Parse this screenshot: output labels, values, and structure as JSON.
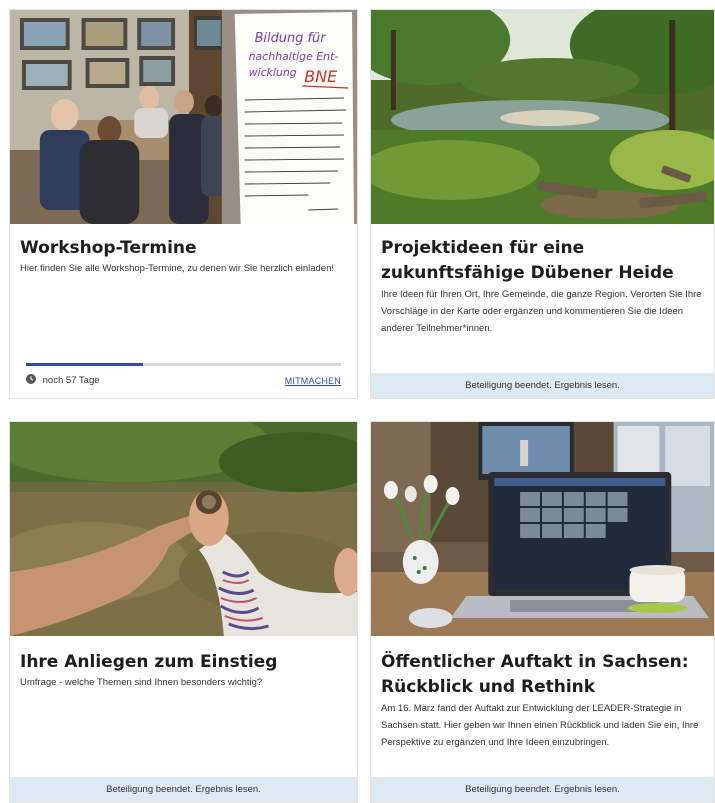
{
  "cards": [
    {
      "title": "Workshop-Termine",
      "description": "Hier finden Sie alle Workshop-Termine, zu denen wir Sie herzlich einladen!",
      "progress": 0.37,
      "days_left": "noch 57 Tage",
      "action_label": "MITMACHEN",
      "image": "workshop-group-flipchart-photo",
      "flipchart_text": "Bildung für nachhaltige Entwicklung BNE"
    },
    {
      "title": "Projektideen für eine zukunftsfähige Dübener Heide",
      "description": "Ihre Ideen für Ihren Ort, Ihre Gemeinde, die ganze Region. Verorten Sie Ihre Vorschläge in der Karte oder ergänzen und kommentieren Sie die Ideen anderer Teilnehmer*innen.",
      "status": "Beteiligung beendet. Ergebnis lesen.",
      "image": "heath-lake-with-benches-photo"
    },
    {
      "title": "Ihre Anliegen zum Einstieg",
      "description": "Umfrage - welche Themen sind Ihnen besonders wichtig?",
      "status": "Beteiligung beendet. Ergebnis lesen.",
      "image": "child-and-hand-pointing-photo"
    },
    {
      "title": "Öffentlicher Auftakt in Sachsen: Rückblick und Rethink",
      "description": "Am 16. März fand der Auftakt zur Entwicklung der LEADER-Strategie in Sachsen statt. Hier geben wir Ihnen einen Rückblick und laden Sie ein, Ihre Perspektive zu ergänzen und Ihre Ideen einzubringen.",
      "status": "Beteiligung beendet. Ergebnis lesen.",
      "image": "laptop-video-conference-photo"
    }
  ],
  "colors": {
    "accent": "#2b4fa8",
    "status_bar": "#dde9f3",
    "progress_track": "#d9d9d9"
  }
}
